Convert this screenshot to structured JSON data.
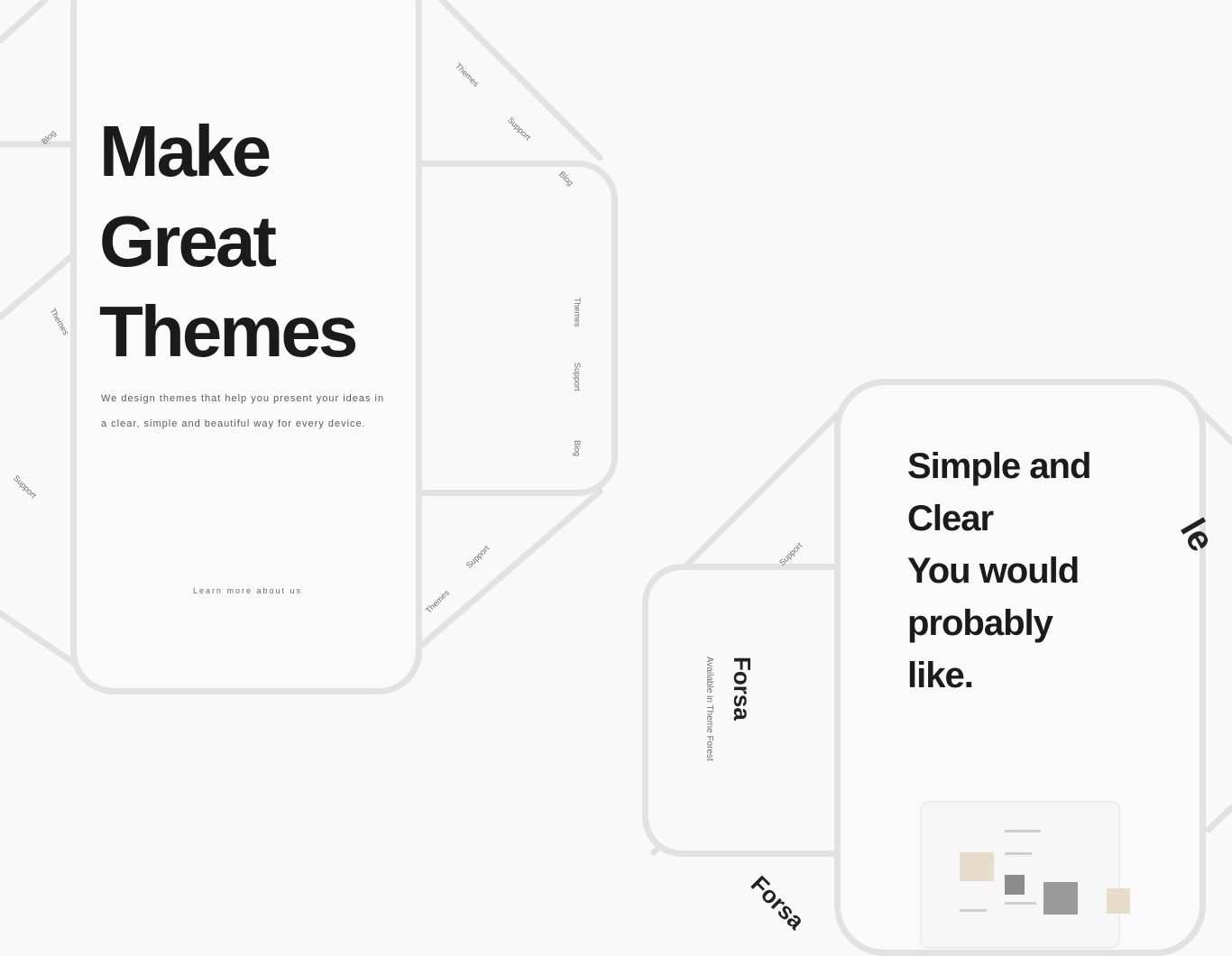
{
  "hero": {
    "line1": "Make",
    "line2": "Great",
    "line3": "Themes",
    "body": "We design themes that help you present your ideas in a clear, simple and beautiful way for every device.",
    "footer_link": "Learn more about us"
  },
  "card2": {
    "line1": "Simple and",
    "line2": "Clear",
    "line3": "You would",
    "line4": "probably",
    "line5": "like."
  },
  "side_labels": {
    "a": "Themes",
    "b": "Support",
    "c": "Blog",
    "d": "Themes",
    "e": "Support",
    "f": "Blog",
    "g": "Themes",
    "h": "Support",
    "i": "Support",
    "j": "Themes",
    "k": "Blog"
  },
  "brand": {
    "name1": "Forsa",
    "name2": "Forsa",
    "sub1": "Available in Theme Forest"
  },
  "colors": {
    "background": "#f9f9f9",
    "frame": "#e2e2e2",
    "text": "#1b1b1b",
    "swatch": "#e6dcc9"
  }
}
